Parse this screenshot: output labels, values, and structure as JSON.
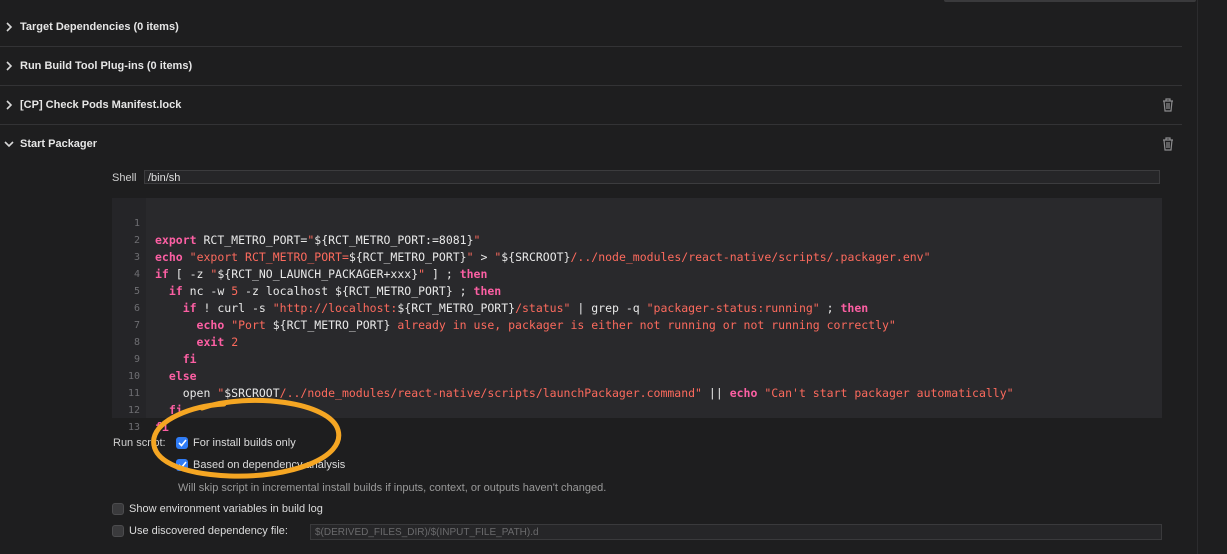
{
  "phases": [
    {
      "label": "Target Dependencies (0 items)",
      "expanded": false,
      "deletable": false
    },
    {
      "label": "Run Build Tool Plug-ins (0 items)",
      "expanded": false,
      "deletable": false
    },
    {
      "label": "[CP] Check Pods Manifest.lock",
      "expanded": false,
      "deletable": true
    },
    {
      "label": "Start Packager",
      "expanded": true,
      "deletable": true
    }
  ],
  "shell": {
    "label": "Shell",
    "value": "/bin/sh"
  },
  "script": {
    "line_numbers": [
      "1",
      "2",
      "3",
      "4",
      "5",
      "6",
      "7",
      "8",
      "9",
      "10",
      "11",
      "12",
      "13"
    ]
  },
  "run_script": {
    "label": "Run script:",
    "install_builds_only": {
      "label": "For install builds only",
      "checked": true
    },
    "dependency_analysis": {
      "label": "Based on dependency analysis",
      "checked": true
    },
    "note": "Will skip script in incremental install builds if inputs, context, or outputs haven't changed."
  },
  "show_env_vars": {
    "label": "Show environment variables in build log",
    "checked": false
  },
  "dependency_file": {
    "label": "Use discovered dependency file:",
    "checked": false,
    "placeholder": "$(DERIVED_FILES_DIR)/$(INPUT_FILE_PATH).d"
  },
  "icons": {
    "collapsed": "chevron-right-icon",
    "expanded": "chevron-down-icon",
    "delete": "trash-icon",
    "check": "checkmark-icon"
  },
  "colors": {
    "keyword": "#fc5fa3",
    "string": "#fc6a5d",
    "checkbox": "#2f7cf6",
    "annotation": "#f5a623"
  }
}
